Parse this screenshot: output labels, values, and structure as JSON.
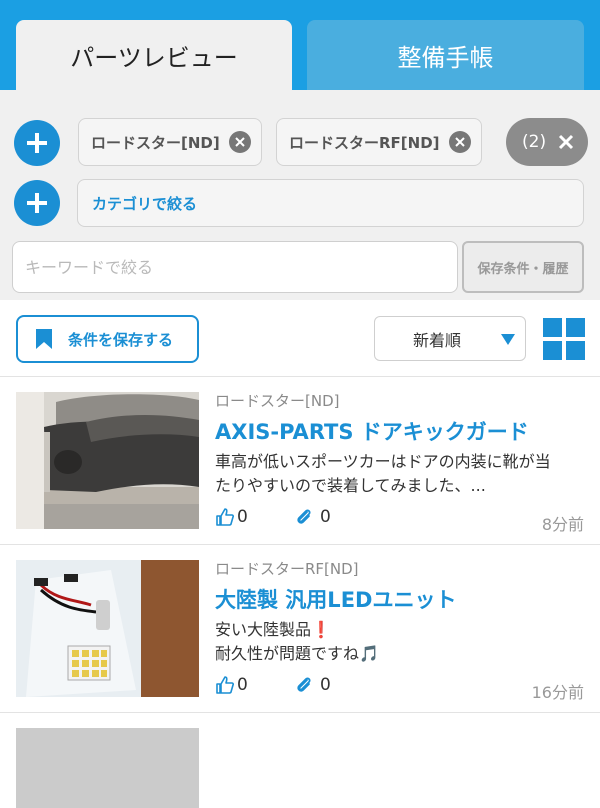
{
  "tabs": [
    {
      "label": "パーツレビュー",
      "active": true
    },
    {
      "label": "整備手帳",
      "active": false
    }
  ],
  "filters": {
    "car_chips": [
      {
        "label": "ロードスター[ND]"
      },
      {
        "label": "ロードスターRF[ND]"
      }
    ],
    "more_count": "(2)",
    "category_label": "カテゴリで絞る",
    "keyword": {
      "value": "",
      "placeholder": "キーワードで絞る"
    },
    "saved_history_label": "保存条件・履歴"
  },
  "toolbar": {
    "save_conditions_label": "条件を保存する",
    "sort_selected": "新着順"
  },
  "items": [
    {
      "car": "ロードスター[ND]",
      "title": "AXIS-PARTS ドアキックガード",
      "excerpt": [
        "車高が低いスポーツカーはドアの内装に靴が当",
        "たりやすいので装着してみました、..."
      ],
      "likes": "0",
      "clips": "0",
      "time": "8分前"
    },
    {
      "car": "ロードスターRF[ND]",
      "title": "大陸製 汎用LEDユニット",
      "excerpt": [
        "安い大陸製品❗️",
        "耐久性が問題ですね🎵"
      ],
      "likes": "0",
      "clips": "0",
      "time": "16分前"
    }
  ],
  "colors": {
    "accent": "#1b8fd4",
    "header_bg": "#1b9fe3",
    "panel_bg": "#f0f0f0"
  }
}
